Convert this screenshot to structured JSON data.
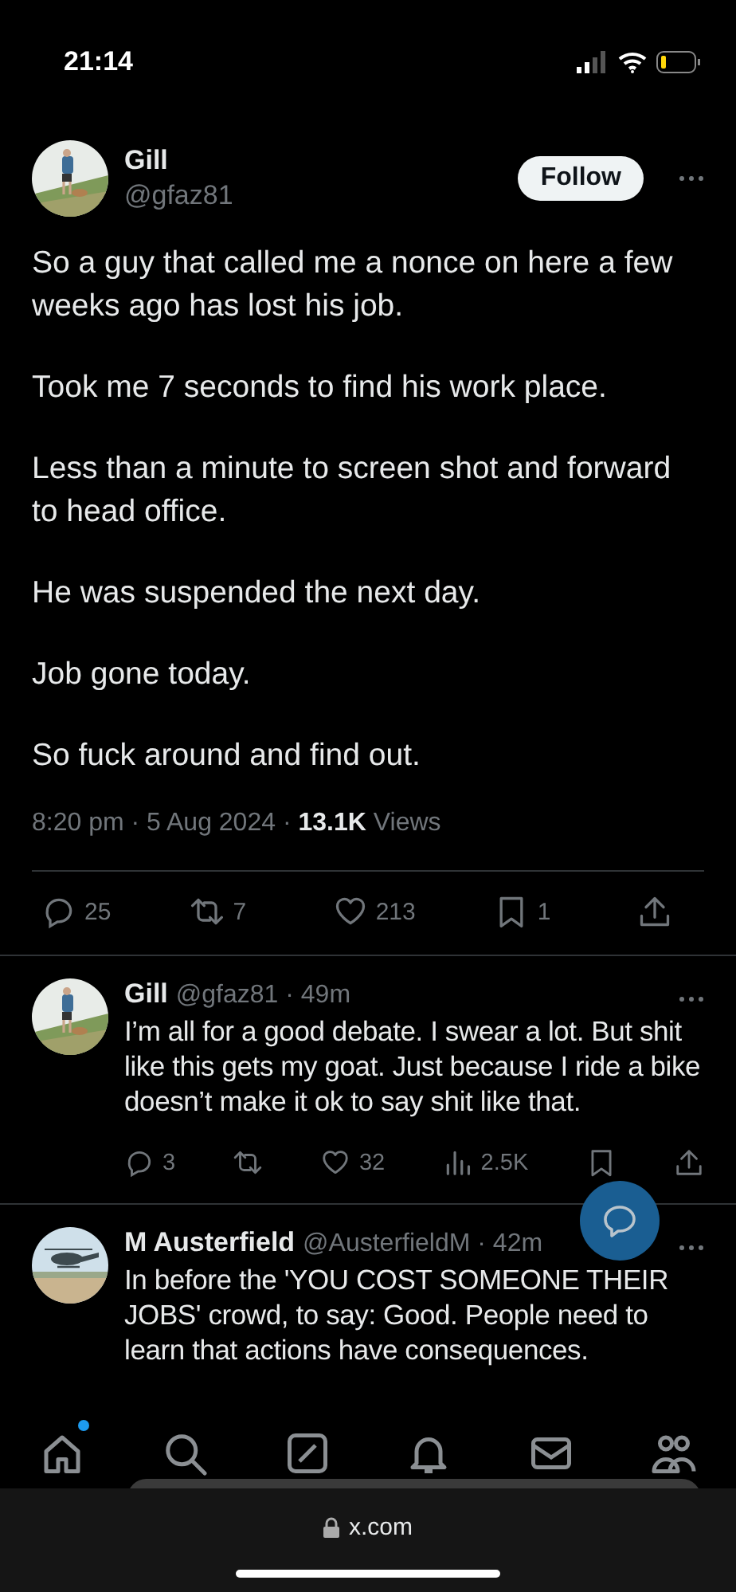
{
  "status_bar": {
    "time": "21:14"
  },
  "post": {
    "name": "Gill",
    "handle": "@gfaz81",
    "follow": "Follow",
    "paragraphs": [
      "So a guy that called me a nonce on here a few weeks ago has lost his job.",
      "Took me 7 seconds to find his work place.",
      "Less than a minute to screen shot and forward to head office.",
      "He was suspended the next day.",
      "Job gone today.",
      "So fuck around and find out."
    ],
    "meta": "8:20 pm · 5 Aug 2024 · ",
    "views_count": "13.1K",
    "views_label": "Views",
    "actions": [
      {
        "kind": "reply",
        "count": "25"
      },
      {
        "kind": "repost",
        "count": "7"
      },
      {
        "kind": "like",
        "count": "213"
      },
      {
        "kind": "bookmark",
        "count": "1"
      },
      {
        "kind": "share"
      }
    ]
  },
  "replies": [
    {
      "name": "Gill",
      "handle": "@gfaz81 · 49m",
      "text": "I’m all for a good debate. I swear a lot. But shit like this gets my goat. Just because I ride a bike doesn’t make it ok to say shit like that.",
      "actions": [
        {
          "kind": "reply",
          "count": "3"
        },
        {
          "kind": "repost"
        },
        {
          "kind": "like",
          "count": "32"
        },
        {
          "kind": "views",
          "count": "2.5K"
        },
        {
          "kind": "bookmark"
        },
        {
          "kind": "share"
        }
      ]
    },
    {
      "name": "M Austerfield",
      "handle": "@AusterfieldM · 42m",
      "text": "In before the 'YOU COST SOMEONE THEIR JOBS' crowd, to say: Good. People need to learn that actions have consequences."
    }
  ],
  "nav": [
    {
      "kind": "home",
      "badge": true
    },
    {
      "kind": "search",
      "badge": false
    },
    {
      "kind": "grok",
      "badge": false
    },
    {
      "kind": "notifications",
      "badge": false
    },
    {
      "kind": "messages",
      "badge": false
    },
    {
      "kind": "communities",
      "badge": false
    }
  ],
  "browser": {
    "url": "x.com"
  }
}
